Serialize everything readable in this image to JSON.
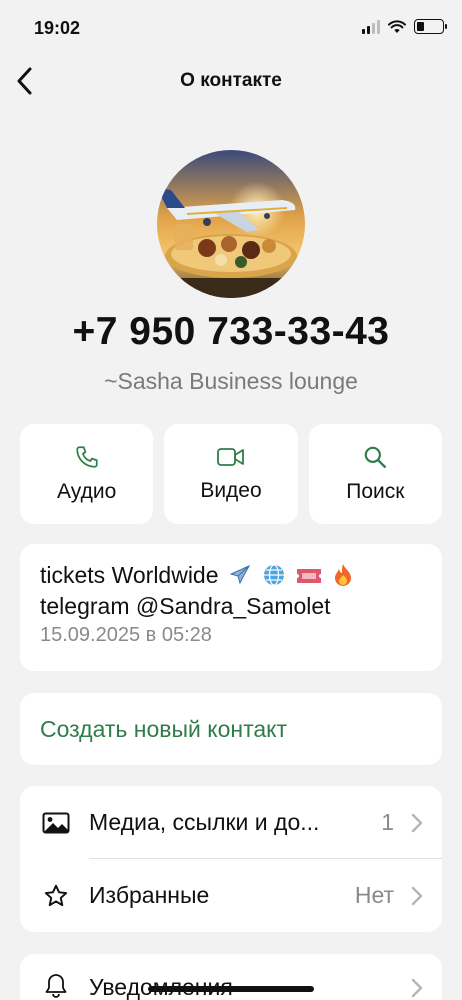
{
  "status": {
    "time": "19:02"
  },
  "nav": {
    "title": "О контакте"
  },
  "contact": {
    "phone": "+7 950 733-33-43",
    "name": "~Sasha Business lounge"
  },
  "actions": [
    {
      "label": "Аудио",
      "icon": "phone-icon"
    },
    {
      "label": "Видео",
      "icon": "video-icon"
    },
    {
      "label": "Поиск",
      "icon": "search-icon"
    }
  ],
  "about": {
    "line1": "tickets Worldwide",
    "line2": "telegram @Sandra_Samolet",
    "date": "15.09.2025 в 05:28"
  },
  "create_contact": {
    "label": "Создать новый контакт"
  },
  "list": [
    {
      "label": "Медиа, ссылки и до...",
      "value": "1",
      "icon": "image-icon"
    },
    {
      "label": "Избранные",
      "value": "Нет",
      "icon": "star-icon"
    }
  ],
  "list2": [
    {
      "label": "Уведомления",
      "icon": "bell-icon"
    }
  ],
  "colors": {
    "accent": "#2f7d4a",
    "background": "#f2f2f2"
  }
}
